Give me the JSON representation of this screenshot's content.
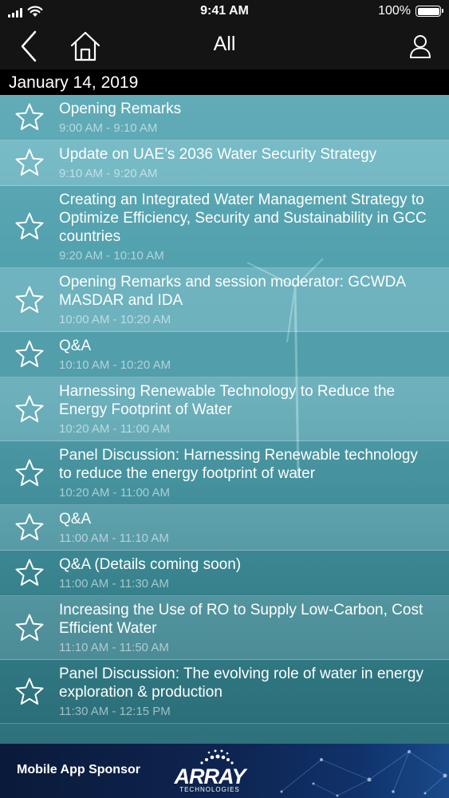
{
  "status_bar": {
    "time": "9:41 AM",
    "battery": "100%"
  },
  "nav": {
    "title": "All",
    "back_icon": "chevron-left-icon",
    "home_icon": "home-icon",
    "profile_icon": "user-icon"
  },
  "date_header": "January 14, 2019",
  "sessions": [
    {
      "title": "Opening Remarks",
      "time": "9:00 AM - 9:10 AM"
    },
    {
      "title": "Update on UAE’s 2036 Water Security Strategy",
      "time": "9:10 AM - 9:20 AM"
    },
    {
      "title": "Creating an Integrated Water Management Strategy to Optimize Efficiency, Security and Sustainability in GCC countries",
      "time": "9:20 AM - 10:10 AM"
    },
    {
      "title": "Opening Remarks and session moderator: GCWDA MASDAR and IDA",
      "time": "10:00 AM - 10:20 AM"
    },
    {
      "title": "Q&A",
      "time": "10:10 AM - 10:20 AM"
    },
    {
      "title": "Harnessing Renewable Technology to Reduce the Energy Footprint of Water",
      "time": "10:20 AM - 11:00 AM"
    },
    {
      "title": "Panel Discussion: Harnessing Renewable technology to reduce the energy footprint of water",
      "time": "10:20 AM - 11:00 AM"
    },
    {
      "title": "Q&A",
      "time": "11:00 AM - 11:10 AM"
    },
    {
      "title": "Q&A (Details coming soon)",
      "time": "11:00 AM - 11:30 AM"
    },
    {
      "title": "Increasing the Use of RO to Supply Low-Carbon, Cost Efficient Water",
      "time": "11:10 AM - 11:50 AM"
    },
    {
      "title": "Panel Discussion: The evolving role of water in energy exploration & production",
      "time": "11:30 AM - 12:15 PM"
    }
  ],
  "sponsor": {
    "label": "Mobile App Sponsor",
    "logo_text": "ARRAY",
    "logo_subtext": "TECHNOLOGIES"
  },
  "colors": {
    "bar_background": "#141414",
    "list_teal": "#5aaab8",
    "sponsor_navy": "#0e2450"
  }
}
